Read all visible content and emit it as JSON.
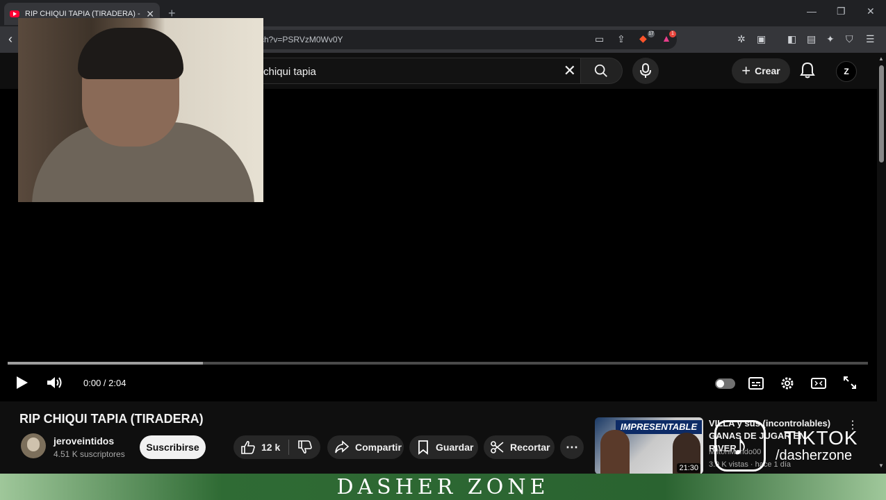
{
  "browser": {
    "tab_title": "RIP CHIQUI TAPIA (TIRADERA) -",
    "url_fragment": "ch?v=PSRVzM0Wv0Y",
    "extension_badges": [
      "17",
      "1"
    ]
  },
  "youtube": {
    "search_query": "chiqui tapia",
    "create_label": "Crear"
  },
  "player": {
    "time": "0:00 / 2:04",
    "buffered_fraction": 0.227
  },
  "video": {
    "title": "RIP CHIQUI TAPIA (TIRADERA)",
    "channel_name": "jeroveintidos",
    "subscribers": "4.51 K suscriptores",
    "subscribe_label": "Suscribirse",
    "likes": "12 k",
    "share_label": "Compartir",
    "save_label": "Guardar",
    "clip_label": "Recortar"
  },
  "recommended": {
    "thumb_text": "IMPRESENTABLE",
    "duration": "21:30",
    "title": "VILLA y sus (incontrolables) GANAS DE JUGAR EN RIVER",
    "channel": "MiltonMarido00",
    "meta": "3.9 K vistas · hace 1 día"
  },
  "overlay": {
    "tiktok_brand": "TIKTOK",
    "tiktok_handle": "/dasherzone",
    "banner_text": "DASHER ZONE"
  }
}
